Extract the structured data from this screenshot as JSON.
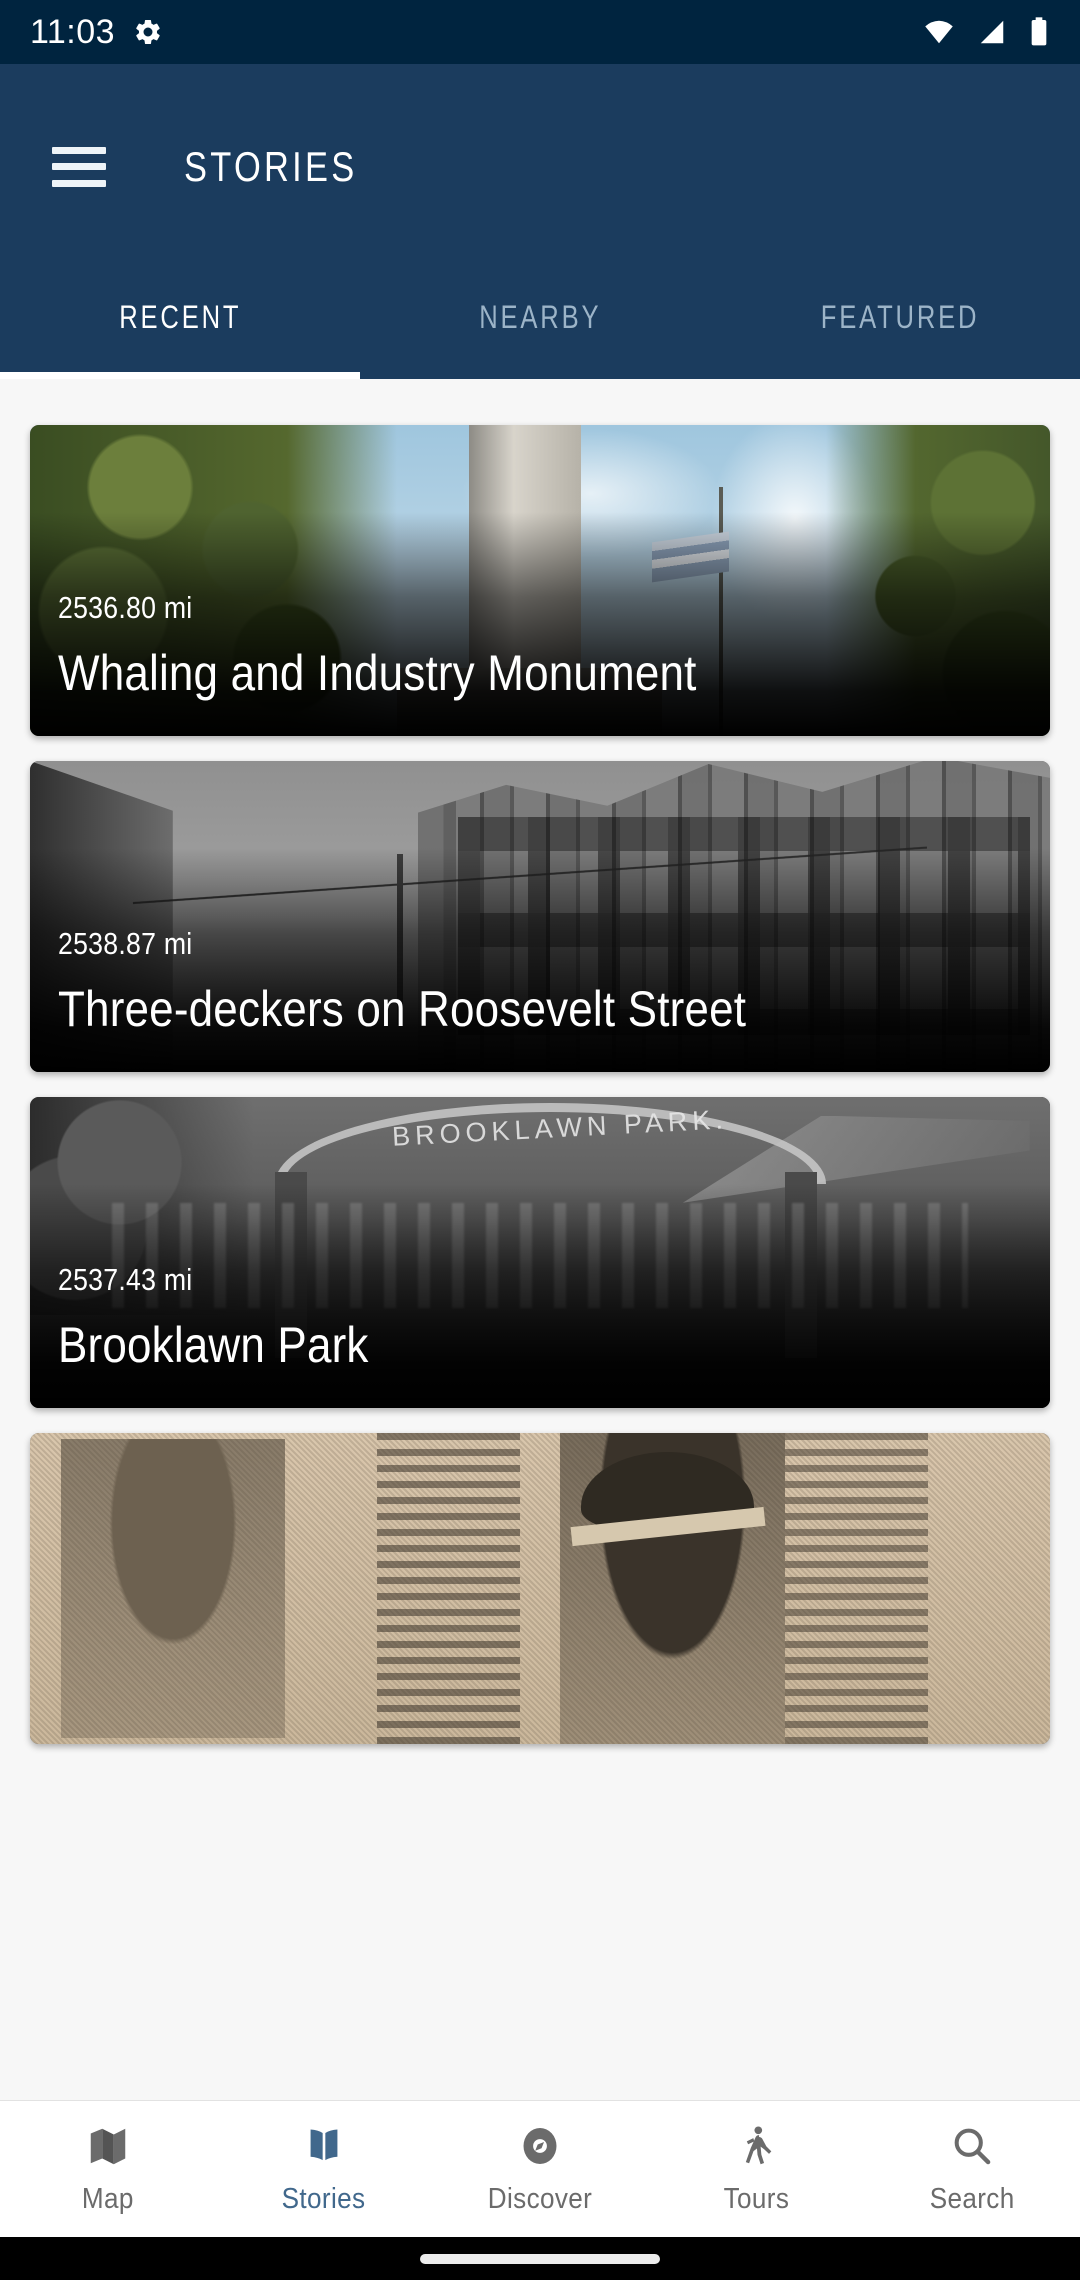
{
  "statusbar": {
    "time": "11:03",
    "icons": [
      "gear-icon",
      "wifi-icon",
      "cellular-signal-icon",
      "battery-icon"
    ]
  },
  "appbar": {
    "menu_icon": "hamburger-menu-icon",
    "title": "STORIES"
  },
  "tabs": {
    "items": [
      {
        "label": "RECENT",
        "active": true
      },
      {
        "label": "NEARBY",
        "active": false
      },
      {
        "label": "FEATURED",
        "active": false
      }
    ]
  },
  "stories": [
    {
      "distance": "2536.80 mi",
      "title": "Whaling and Industry Monument",
      "image": "colorized-postcard-monument-with-flagpole-and-trees"
    },
    {
      "distance": "2538.87 mi",
      "title": "Three-deckers on Roosevelt Street",
      "image": "black-and-white-photo-of-triple-decker-houses-on-street"
    },
    {
      "distance": "2537.43 mi",
      "title": "Brooklawn Park",
      "image": "black-and-white-photo-of-brooklawn-park-entrance-arch",
      "arch_text": "BROOKLAWN PARK."
    },
    {
      "distance": "",
      "title": "",
      "image": "sepia-newspaper-clipping-with-uniformed-officers"
    }
  ],
  "bottomnav": {
    "items": [
      {
        "label": "Map",
        "icon": "map-icon",
        "active": false
      },
      {
        "label": "Stories",
        "icon": "book-icon",
        "active": true
      },
      {
        "label": "Discover",
        "icon": "compass-icon",
        "active": false
      },
      {
        "label": "Tours",
        "icon": "walking-person-icon",
        "active": false
      },
      {
        "label": "Search",
        "icon": "search-icon",
        "active": false
      }
    ]
  },
  "colors": {
    "status_bar": "#00243f",
    "app_bar": "#1b3c5e",
    "accent_active": "#41688c",
    "nav_inactive": "#6b6b6b",
    "list_background": "#f7f7f7"
  }
}
